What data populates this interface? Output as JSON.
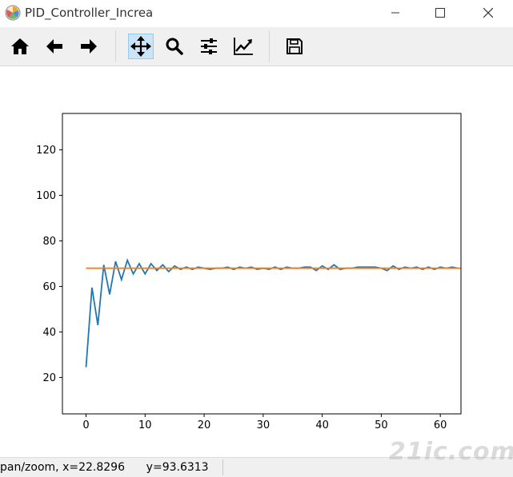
{
  "window": {
    "title": "PID_Controller_Increa"
  },
  "toolbar": {
    "buttons": [
      {
        "name": "home",
        "icon": "home-icon"
      },
      {
        "name": "back",
        "icon": "arrow-left-icon"
      },
      {
        "name": "forward",
        "icon": "arrow-right-icon"
      },
      {
        "name": "pan",
        "icon": "move-icon",
        "active": true
      },
      {
        "name": "zoom",
        "icon": "magnifier-icon"
      },
      {
        "name": "configure-subplots",
        "icon": "sliders-icon"
      },
      {
        "name": "edit-axis",
        "icon": "line-chart-icon"
      },
      {
        "name": "save",
        "icon": "floppy-icon"
      }
    ]
  },
  "chart_data": {
    "type": "line",
    "xlim": [
      -4,
      63.5
    ],
    "ylim": [
      4,
      136
    ],
    "xticks": [
      0,
      10,
      20,
      30,
      40,
      50,
      60
    ],
    "yticks": [
      20,
      40,
      60,
      80,
      100,
      120
    ],
    "grid": false,
    "series": [
      {
        "color": "#1f77b4",
        "x": [
          0,
          1,
          2,
          3,
          4,
          5,
          6,
          7,
          8,
          9,
          10,
          11,
          12,
          13,
          14,
          15,
          16,
          17,
          18,
          19,
          20,
          21,
          22,
          23,
          24,
          25,
          26,
          27,
          28,
          29,
          30,
          31,
          32,
          33,
          34,
          35,
          36,
          37,
          38,
          39,
          40,
          41,
          42,
          43,
          44,
          45,
          46,
          47,
          48,
          49,
          50,
          51,
          52,
          53,
          54,
          55,
          56,
          57,
          58,
          59,
          60,
          61,
          62,
          63
        ],
        "values": [
          24.5,
          59.5,
          43,
          69.5,
          56.5,
          71,
          63,
          71.5,
          65.5,
          70,
          65.5,
          70,
          67,
          69.5,
          66.5,
          69,
          67.5,
          68.5,
          67.5,
          68.5,
          68,
          67.5,
          68,
          68,
          68.5,
          67.5,
          68.5,
          68,
          68.5,
          67.5,
          68,
          67.5,
          68.5,
          67.5,
          68.5,
          68,
          68,
          68.5,
          68.5,
          67,
          69,
          67.5,
          69.5,
          67.5,
          68,
          68,
          68.5,
          68.5,
          68.5,
          68.5,
          68,
          67,
          69,
          67.5,
          68.5,
          68,
          68.5,
          67.5,
          68.5,
          67.5,
          68.5,
          68,
          68.5,
          68
        ]
      },
      {
        "color": "#ff7f0e",
        "x": [
          0,
          63.5
        ],
        "values": [
          68,
          68
        ]
      }
    ]
  },
  "statusbar": {
    "message": "pan/zoom, x=22.8296      y=93.6313"
  },
  "watermark": {
    "text": "21ic.com"
  }
}
